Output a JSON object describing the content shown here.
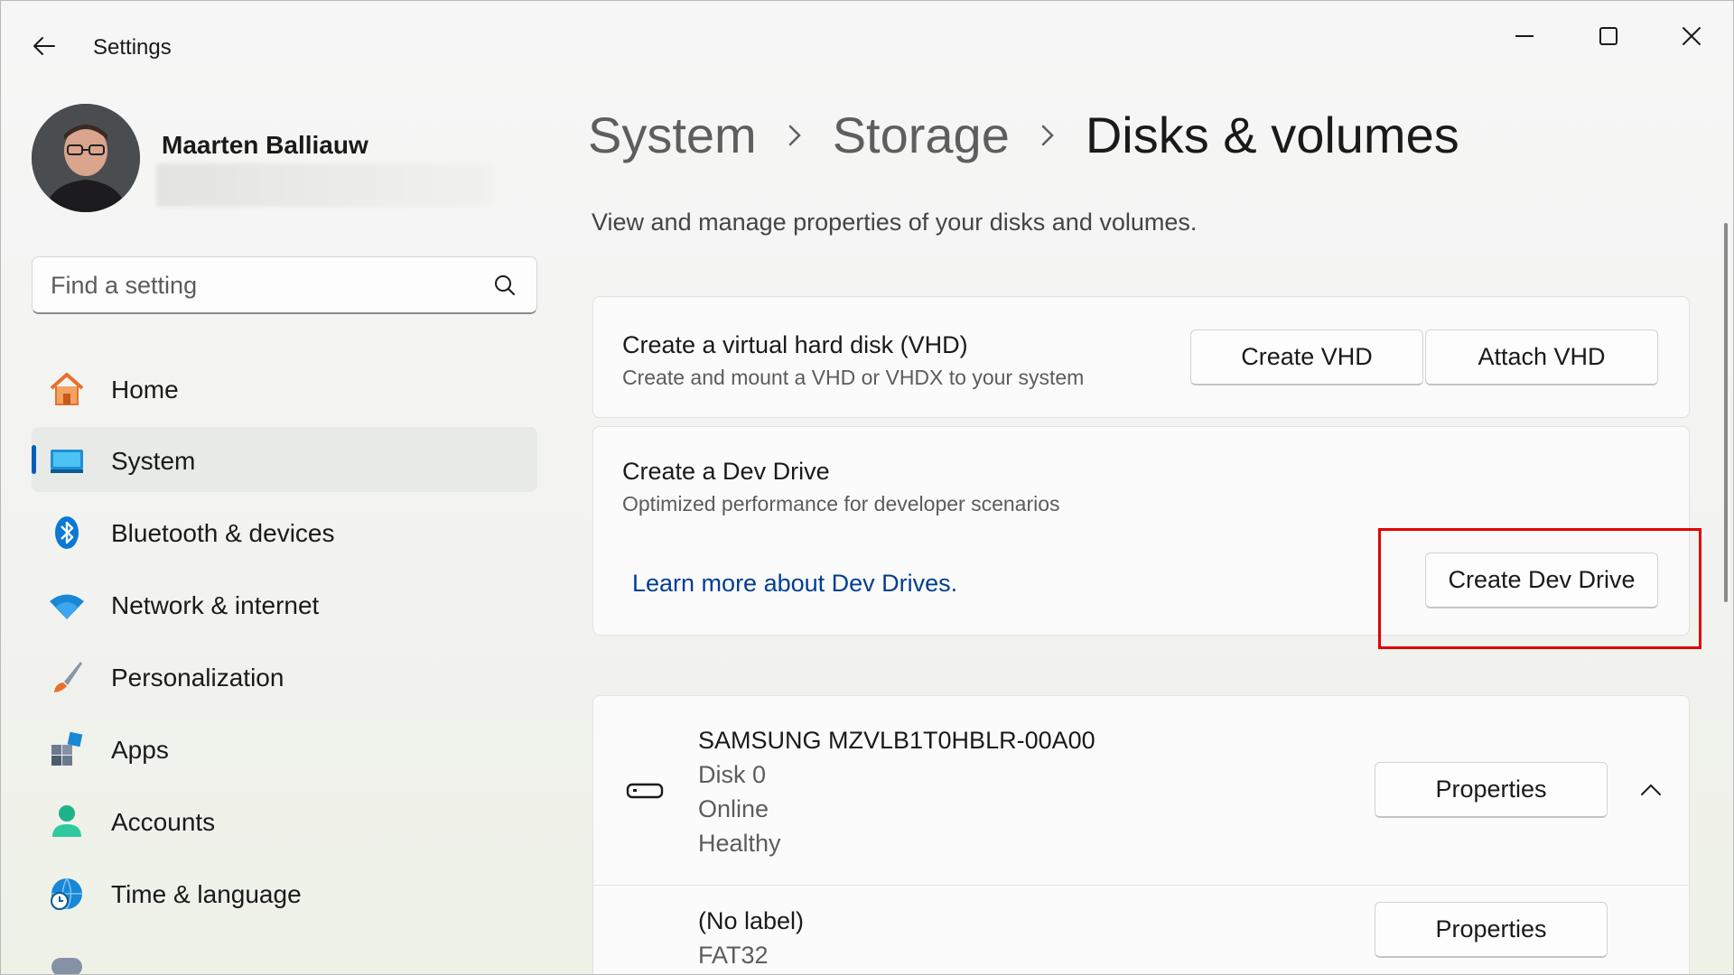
{
  "window": {
    "title": "Settings"
  },
  "user": {
    "name": "Maarten Balliauw"
  },
  "search": {
    "placeholder": "Find a setting"
  },
  "nav": {
    "items": [
      {
        "label": "Home",
        "icon": "home-icon"
      },
      {
        "label": "System",
        "icon": "system-icon",
        "active": true
      },
      {
        "label": "Bluetooth & devices",
        "icon": "bluetooth-icon"
      },
      {
        "label": "Network & internet",
        "icon": "wifi-icon"
      },
      {
        "label": "Personalization",
        "icon": "brush-icon"
      },
      {
        "label": "Apps",
        "icon": "apps-icon"
      },
      {
        "label": "Accounts",
        "icon": "person-icon"
      },
      {
        "label": "Time & language",
        "icon": "globe-clock-icon"
      }
    ]
  },
  "breadcrumb": {
    "items": [
      "System",
      "Storage"
    ],
    "current": "Disks & volumes"
  },
  "page": {
    "subtitle": "View and manage properties of your disks and volumes."
  },
  "vhd": {
    "title": "Create a virtual hard disk (VHD)",
    "subtitle": "Create and mount a VHD or VHDX to your system",
    "create_label": "Create VHD",
    "attach_label": "Attach VHD"
  },
  "devdrive": {
    "title": "Create a Dev Drive",
    "subtitle": "Optimized performance for developer scenarios",
    "link": "Learn more about Dev Drives.",
    "button": "Create Dev Drive"
  },
  "disk": {
    "name": "SAMSUNG MZVLB1T0HBLR-00A00",
    "number": "Disk 0",
    "status": "Online",
    "health": "Healthy",
    "properties_label": "Properties",
    "volume": {
      "label": "(No label)",
      "fs": "FAT32",
      "properties_label": "Properties"
    }
  },
  "colors": {
    "accent": "#005fb8",
    "link": "#003e92",
    "highlight": "#e00000"
  }
}
